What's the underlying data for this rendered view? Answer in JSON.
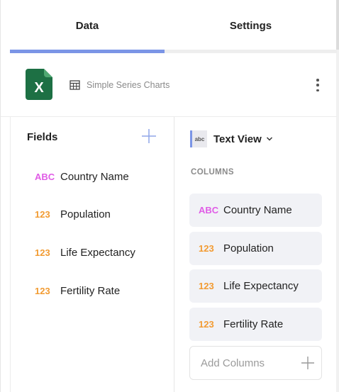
{
  "tabs": [
    {
      "label": "Data",
      "active": true
    },
    {
      "label": "Settings",
      "active": false
    }
  ],
  "datasource": {
    "file_icon": "excel-icon",
    "file_letter": "X",
    "table_icon": "table-icon",
    "name": "Simple Series Charts"
  },
  "fields": {
    "title": "Fields",
    "items": [
      {
        "type": "ABC",
        "label": "Country Name"
      },
      {
        "type": "123",
        "label": "Population"
      },
      {
        "type": "123",
        "label": "Life Expectancy"
      },
      {
        "type": "123",
        "label": "Fertility Rate"
      }
    ]
  },
  "visualization": {
    "icon_text": "abc",
    "label": "Text View",
    "columns_title": "COLUMNS",
    "columns": [
      {
        "type": "ABC",
        "label": "Country Name"
      },
      {
        "type": "123",
        "label": "Population"
      },
      {
        "type": "123",
        "label": "Life Expectancy"
      },
      {
        "type": "123",
        "label": "Fertility Rate"
      }
    ],
    "add_columns_label": "Add Columns"
  },
  "colors": {
    "accent": "#7b95e6",
    "text_type": "#e05ce6",
    "number_type": "#f29b32",
    "excel_green": "#1d7044"
  }
}
